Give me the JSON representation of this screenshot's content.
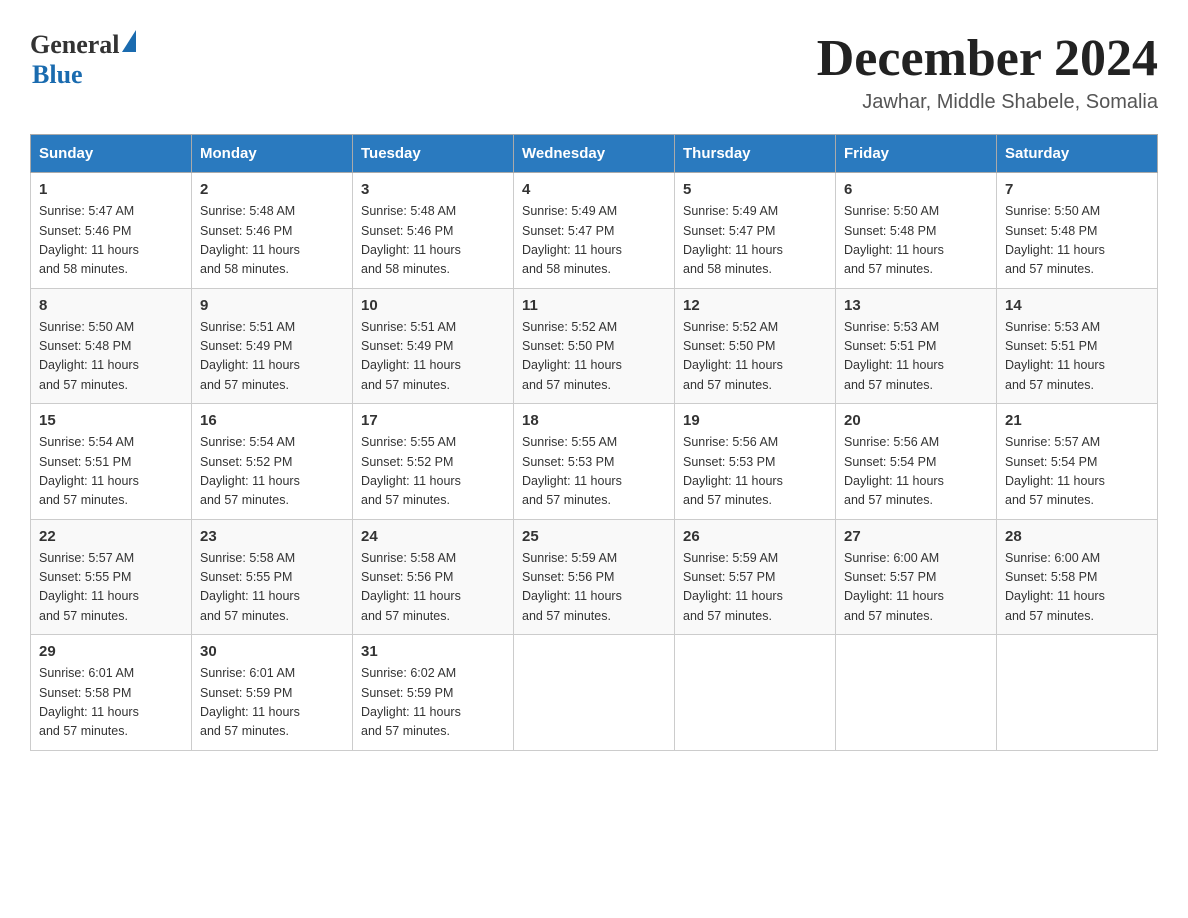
{
  "header": {
    "logo_general": "General",
    "logo_blue": "Blue",
    "month_title": "December 2024",
    "location": "Jawhar, Middle Shabele, Somalia"
  },
  "days_of_week": [
    "Sunday",
    "Monday",
    "Tuesday",
    "Wednesday",
    "Thursday",
    "Friday",
    "Saturday"
  ],
  "weeks": [
    [
      {
        "day": "1",
        "sunrise": "5:47 AM",
        "sunset": "5:46 PM",
        "daylight": "11 hours and 58 minutes."
      },
      {
        "day": "2",
        "sunrise": "5:48 AM",
        "sunset": "5:46 PM",
        "daylight": "11 hours and 58 minutes."
      },
      {
        "day": "3",
        "sunrise": "5:48 AM",
        "sunset": "5:46 PM",
        "daylight": "11 hours and 58 minutes."
      },
      {
        "day": "4",
        "sunrise": "5:49 AM",
        "sunset": "5:47 PM",
        "daylight": "11 hours and 58 minutes."
      },
      {
        "day": "5",
        "sunrise": "5:49 AM",
        "sunset": "5:47 PM",
        "daylight": "11 hours and 58 minutes."
      },
      {
        "day": "6",
        "sunrise": "5:50 AM",
        "sunset": "5:48 PM",
        "daylight": "11 hours and 57 minutes."
      },
      {
        "day": "7",
        "sunrise": "5:50 AM",
        "sunset": "5:48 PM",
        "daylight": "11 hours and 57 minutes."
      }
    ],
    [
      {
        "day": "8",
        "sunrise": "5:50 AM",
        "sunset": "5:48 PM",
        "daylight": "11 hours and 57 minutes."
      },
      {
        "day": "9",
        "sunrise": "5:51 AM",
        "sunset": "5:49 PM",
        "daylight": "11 hours and 57 minutes."
      },
      {
        "day": "10",
        "sunrise": "5:51 AM",
        "sunset": "5:49 PM",
        "daylight": "11 hours and 57 minutes."
      },
      {
        "day": "11",
        "sunrise": "5:52 AM",
        "sunset": "5:50 PM",
        "daylight": "11 hours and 57 minutes."
      },
      {
        "day": "12",
        "sunrise": "5:52 AM",
        "sunset": "5:50 PM",
        "daylight": "11 hours and 57 minutes."
      },
      {
        "day": "13",
        "sunrise": "5:53 AM",
        "sunset": "5:51 PM",
        "daylight": "11 hours and 57 minutes."
      },
      {
        "day": "14",
        "sunrise": "5:53 AM",
        "sunset": "5:51 PM",
        "daylight": "11 hours and 57 minutes."
      }
    ],
    [
      {
        "day": "15",
        "sunrise": "5:54 AM",
        "sunset": "5:51 PM",
        "daylight": "11 hours and 57 minutes."
      },
      {
        "day": "16",
        "sunrise": "5:54 AM",
        "sunset": "5:52 PM",
        "daylight": "11 hours and 57 minutes."
      },
      {
        "day": "17",
        "sunrise": "5:55 AM",
        "sunset": "5:52 PM",
        "daylight": "11 hours and 57 minutes."
      },
      {
        "day": "18",
        "sunrise": "5:55 AM",
        "sunset": "5:53 PM",
        "daylight": "11 hours and 57 minutes."
      },
      {
        "day": "19",
        "sunrise": "5:56 AM",
        "sunset": "5:53 PM",
        "daylight": "11 hours and 57 minutes."
      },
      {
        "day": "20",
        "sunrise": "5:56 AM",
        "sunset": "5:54 PM",
        "daylight": "11 hours and 57 minutes."
      },
      {
        "day": "21",
        "sunrise": "5:57 AM",
        "sunset": "5:54 PM",
        "daylight": "11 hours and 57 minutes."
      }
    ],
    [
      {
        "day": "22",
        "sunrise": "5:57 AM",
        "sunset": "5:55 PM",
        "daylight": "11 hours and 57 minutes."
      },
      {
        "day": "23",
        "sunrise": "5:58 AM",
        "sunset": "5:55 PM",
        "daylight": "11 hours and 57 minutes."
      },
      {
        "day": "24",
        "sunrise": "5:58 AM",
        "sunset": "5:56 PM",
        "daylight": "11 hours and 57 minutes."
      },
      {
        "day": "25",
        "sunrise": "5:59 AM",
        "sunset": "5:56 PM",
        "daylight": "11 hours and 57 minutes."
      },
      {
        "day": "26",
        "sunrise": "5:59 AM",
        "sunset": "5:57 PM",
        "daylight": "11 hours and 57 minutes."
      },
      {
        "day": "27",
        "sunrise": "6:00 AM",
        "sunset": "5:57 PM",
        "daylight": "11 hours and 57 minutes."
      },
      {
        "day": "28",
        "sunrise": "6:00 AM",
        "sunset": "5:58 PM",
        "daylight": "11 hours and 57 minutes."
      }
    ],
    [
      {
        "day": "29",
        "sunrise": "6:01 AM",
        "sunset": "5:58 PM",
        "daylight": "11 hours and 57 minutes."
      },
      {
        "day": "30",
        "sunrise": "6:01 AM",
        "sunset": "5:59 PM",
        "daylight": "11 hours and 57 minutes."
      },
      {
        "day": "31",
        "sunrise": "6:02 AM",
        "sunset": "5:59 PM",
        "daylight": "11 hours and 57 minutes."
      },
      null,
      null,
      null,
      null
    ]
  ],
  "labels": {
    "sunrise": "Sunrise:",
    "sunset": "Sunset:",
    "daylight": "Daylight:"
  }
}
